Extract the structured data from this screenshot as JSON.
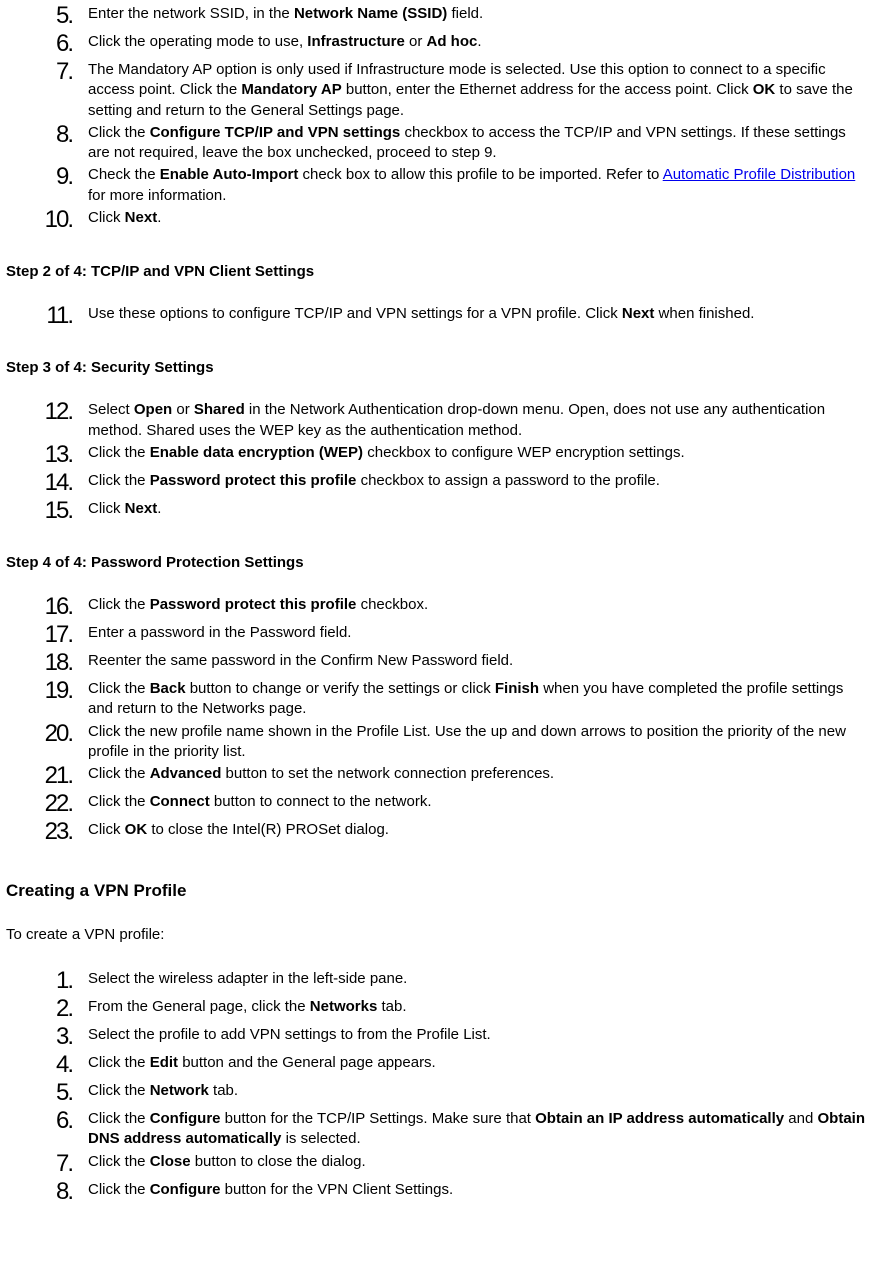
{
  "list1": [
    {
      "num": "5",
      "segments": [
        {
          "t": "Enter the network SSID, in the "
        },
        {
          "t": "Network Name (SSID)",
          "b": true
        },
        {
          "t": " field."
        }
      ]
    },
    {
      "num": "6",
      "segments": [
        {
          "t": "Click the operating mode to use, "
        },
        {
          "t": "Infrastructure",
          "b": true
        },
        {
          "t": " or "
        },
        {
          "t": "Ad hoc",
          "b": true
        },
        {
          "t": "."
        }
      ]
    },
    {
      "num": "7",
      "segments": [
        {
          "t": "The Mandatory AP option is only used if Infrastructure mode is selected. Use this option to connect to a specific access point. Click the "
        },
        {
          "t": "Mandatory AP",
          "b": true
        },
        {
          "t": " button, enter the Ethernet address for the access point. Click "
        },
        {
          "t": "OK",
          "b": true
        },
        {
          "t": " to save the setting and return to the General Settings page."
        }
      ]
    },
    {
      "num": "8",
      "segments": [
        {
          "t": "Click the "
        },
        {
          "t": "Configure TCP/IP and VPN settings",
          "b": true
        },
        {
          "t": " checkbox to access the TCP/IP and VPN settings. If these settings are not required, leave the box unchecked, proceed to step 9."
        }
      ]
    },
    {
      "num": "9",
      "segments": [
        {
          "t": "Check the "
        },
        {
          "t": "Enable Auto-Import",
          "b": true
        },
        {
          "t": " check box to allow this profile to be imported. Refer to "
        },
        {
          "t": "Automatic Profile Distribution",
          "link": true
        },
        {
          "t": " for more information."
        }
      ]
    },
    {
      "num": "10",
      "segments": [
        {
          "t": "Click "
        },
        {
          "t": "Next",
          "b": true
        },
        {
          "t": "."
        }
      ]
    }
  ],
  "step2_heading": "Step 2 of 4: TCP/IP and VPN Client Settings",
  "list2": [
    {
      "num": "11",
      "segments": [
        {
          "t": "Use these options to configure TCP/IP and VPN settings for a VPN profile. Click "
        },
        {
          "t": "Next",
          "b": true
        },
        {
          "t": " when finished."
        }
      ]
    }
  ],
  "step3_heading": "Step 3 of 4: Security Settings",
  "list3": [
    {
      "num": "12",
      "segments": [
        {
          "t": "Select "
        },
        {
          "t": "Open",
          "b": true
        },
        {
          "t": " or "
        },
        {
          "t": "Shared",
          "b": true
        },
        {
          "t": " in the Network Authentication drop-down menu. Open, does not use any authentication method. Shared uses the WEP key as the authentication method."
        }
      ]
    },
    {
      "num": "13",
      "segments": [
        {
          "t": "Click the "
        },
        {
          "t": "Enable data encryption (WEP)",
          "b": true
        },
        {
          "t": " checkbox to configure WEP encryption settings."
        }
      ]
    },
    {
      "num": "14",
      "segments": [
        {
          "t": "Click the "
        },
        {
          "t": "Password protect this profile",
          "b": true
        },
        {
          "t": " checkbox to assign a password to the profile."
        }
      ]
    },
    {
      "num": "15",
      "segments": [
        {
          "t": "Click "
        },
        {
          "t": "Next",
          "b": true
        },
        {
          "t": "."
        }
      ]
    }
  ],
  "step4_heading": "Step 4 of 4: Password Protection Settings",
  "list4": [
    {
      "num": "16",
      "segments": [
        {
          "t": "Click the "
        },
        {
          "t": "Password protect this profile",
          "b": true
        },
        {
          "t": " checkbox."
        }
      ]
    },
    {
      "num": "17",
      "segments": [
        {
          "t": "Enter a password in the Password field."
        }
      ]
    },
    {
      "num": "18",
      "segments": [
        {
          "t": "Reenter the same password in the Confirm New Password field."
        }
      ]
    },
    {
      "num": "19",
      "segments": [
        {
          "t": "Click the "
        },
        {
          "t": "Back",
          "b": true
        },
        {
          "t": " button to change or verify the settings or click "
        },
        {
          "t": "Finish",
          "b": true
        },
        {
          "t": " when you have completed the profile settings and return to the Networks page."
        }
      ]
    },
    {
      "num": "20",
      "segments": [
        {
          "t": "Click the new profile name shown in the Profile List. Use the up and down arrows to position the priority of the new profile in the priority list."
        }
      ]
    },
    {
      "num": "21",
      "segments": [
        {
          "t": "Click the "
        },
        {
          "t": "Advanced",
          "b": true
        },
        {
          "t": " button to set the network connection preferences."
        }
      ]
    },
    {
      "num": "22",
      "segments": [
        {
          "t": "Click the "
        },
        {
          "t": "Connect",
          "b": true
        },
        {
          "t": " button to connect to the network."
        }
      ]
    },
    {
      "num": "23",
      "segments": [
        {
          "t": "Click "
        },
        {
          "t": "OK",
          "b": true
        },
        {
          "t": " to close the Intel(R) PROSet dialog."
        }
      ]
    }
  ],
  "section_heading": "Creating a VPN Profile",
  "section_lead": "To create a VPN profile:",
  "list5": [
    {
      "num": "1",
      "segments": [
        {
          "t": "Select the wireless adapter in the left-side pane."
        }
      ]
    },
    {
      "num": "2",
      "segments": [
        {
          "t": "From the General page, click the "
        },
        {
          "t": "Networks",
          "b": true
        },
        {
          "t": " tab."
        }
      ]
    },
    {
      "num": "3",
      "segments": [
        {
          "t": "Select the profile to add VPN settings to from the Profile List."
        }
      ]
    },
    {
      "num": "4",
      "segments": [
        {
          "t": "Click the "
        },
        {
          "t": "Edit",
          "b": true
        },
        {
          "t": " button and the General page appears."
        }
      ]
    },
    {
      "num": "5",
      "segments": [
        {
          "t": "Click the "
        },
        {
          "t": "Network",
          "b": true
        },
        {
          "t": " tab."
        }
      ]
    },
    {
      "num": "6",
      "segments": [
        {
          "t": "Click the "
        },
        {
          "t": "Configure",
          "b": true
        },
        {
          "t": " button for the TCP/IP Settings. Make sure that "
        },
        {
          "t": "Obtain an IP address automatically",
          "b": true
        },
        {
          "t": " and "
        },
        {
          "t": "Obtain DNS address automatically",
          "b": true
        },
        {
          "t": " is selected."
        }
      ]
    },
    {
      "num": "7",
      "segments": [
        {
          "t": "Click the "
        },
        {
          "t": "Close",
          "b": true
        },
        {
          "t": " button to close the dialog."
        }
      ]
    },
    {
      "num": "8",
      "segments": [
        {
          "t": "Click the "
        },
        {
          "t": "Configure",
          "b": true
        },
        {
          "t": " button for the VPN Client Settings."
        }
      ]
    }
  ]
}
